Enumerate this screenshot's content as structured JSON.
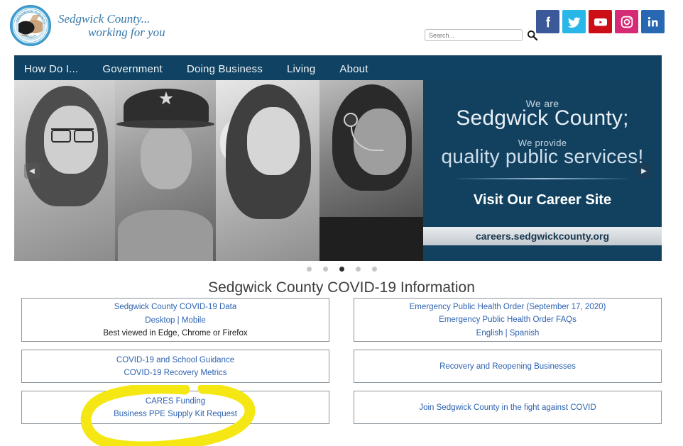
{
  "header": {
    "logo_alt": "Sedgwick County Kansas seal",
    "title_line1": "Sedgwick County...",
    "title_line2": "working for you",
    "search": {
      "placeholder": "Search...",
      "value": "",
      "button_label": "Search"
    },
    "social": [
      {
        "name": "facebook",
        "label": "f",
        "color": "#3b5998"
      },
      {
        "name": "twitter",
        "label": "t",
        "color": "#29b6e8"
      },
      {
        "name": "youtube",
        "label": "y",
        "color": "#cc0f16"
      },
      {
        "name": "instagram",
        "label": "i",
        "color": "#d62976"
      },
      {
        "name": "linkedin",
        "label": "in",
        "color": "#2867b2"
      }
    ]
  },
  "nav": {
    "background": "#0f4263",
    "items": [
      {
        "label": "How Do I..."
      },
      {
        "label": "Government"
      },
      {
        "label": "Doing Business"
      },
      {
        "label": "Living"
      },
      {
        "label": "About"
      }
    ]
  },
  "hero": {
    "we_are": "We are",
    "headline1": "Sedgwick County;",
    "we_provide": "We provide",
    "headline2": "quality public services!",
    "career_title": "Visit Our Career Site",
    "career_url": "careers.sedgwickcounty.org",
    "prev_label": "◀",
    "next_label": "▶",
    "panel_color": "#124160",
    "photos": [
      {
        "name": "photo-woman-glasses"
      },
      {
        "name": "photo-deputy-sheriff"
      },
      {
        "name": "photo-woman-smiling"
      },
      {
        "name": "photo-call-center-agent"
      }
    ],
    "dots": [
      {
        "active": false
      },
      {
        "active": false
      },
      {
        "active": true
      },
      {
        "active": false
      },
      {
        "active": false
      }
    ],
    "active_slide": 3,
    "slide_count": 5
  },
  "covid": {
    "heading": "Sedgwick County COVID-19 Information",
    "cards": [
      {
        "name": "covid-data-card",
        "height": "tall",
        "lines": [
          {
            "type": "link",
            "text": "Sedgwick County COVID-19 Data"
          },
          {
            "type": "link-pair",
            "text": "Desktop | Mobile",
            "a": "Desktop",
            "sep": " | ",
            "b": "Mobile"
          },
          {
            "type": "plain",
            "text": "Best viewed in Edge, Chrome or Firefox"
          }
        ]
      },
      {
        "name": "emergency-health-order-card",
        "height": "tall",
        "lines": [
          {
            "type": "link",
            "text": "Emergency Public Health Order (September 17, 2020)"
          },
          {
            "type": "link",
            "text": "Emergency Public Health Order FAQs"
          },
          {
            "type": "link-pair",
            "text": "English | Spanish",
            "a": "English",
            "sep": "  |  ",
            "b": "Spanish"
          }
        ]
      },
      {
        "name": "school-guidance-card",
        "height": "short",
        "lines": [
          {
            "type": "link",
            "text": "COVID-19 and School Guidance"
          },
          {
            "type": "link",
            "text": "COVID-19 Recovery Metrics"
          }
        ]
      },
      {
        "name": "recovery-reopening-card",
        "height": "short",
        "lines": [
          {
            "type": "link",
            "text": "Recovery and Reopening Businesses"
          }
        ]
      },
      {
        "name": "cares-funding-card",
        "height": "short",
        "lines": [
          {
            "type": "link",
            "text": "CARES Funding"
          },
          {
            "type": "link",
            "text": "Business PPE Supply Kit Request"
          }
        ]
      },
      {
        "name": "fight-against-covid-card",
        "height": "short",
        "lines": [
          {
            "type": "link",
            "text": "Join Sedgwick County in the fight against COVID"
          }
        ]
      }
    ]
  },
  "annotation": {
    "name": "yellow-highlight-circle",
    "color": "#f5e713",
    "target": "cares-funding-card",
    "shape": "hand-drawn-open-oval"
  }
}
